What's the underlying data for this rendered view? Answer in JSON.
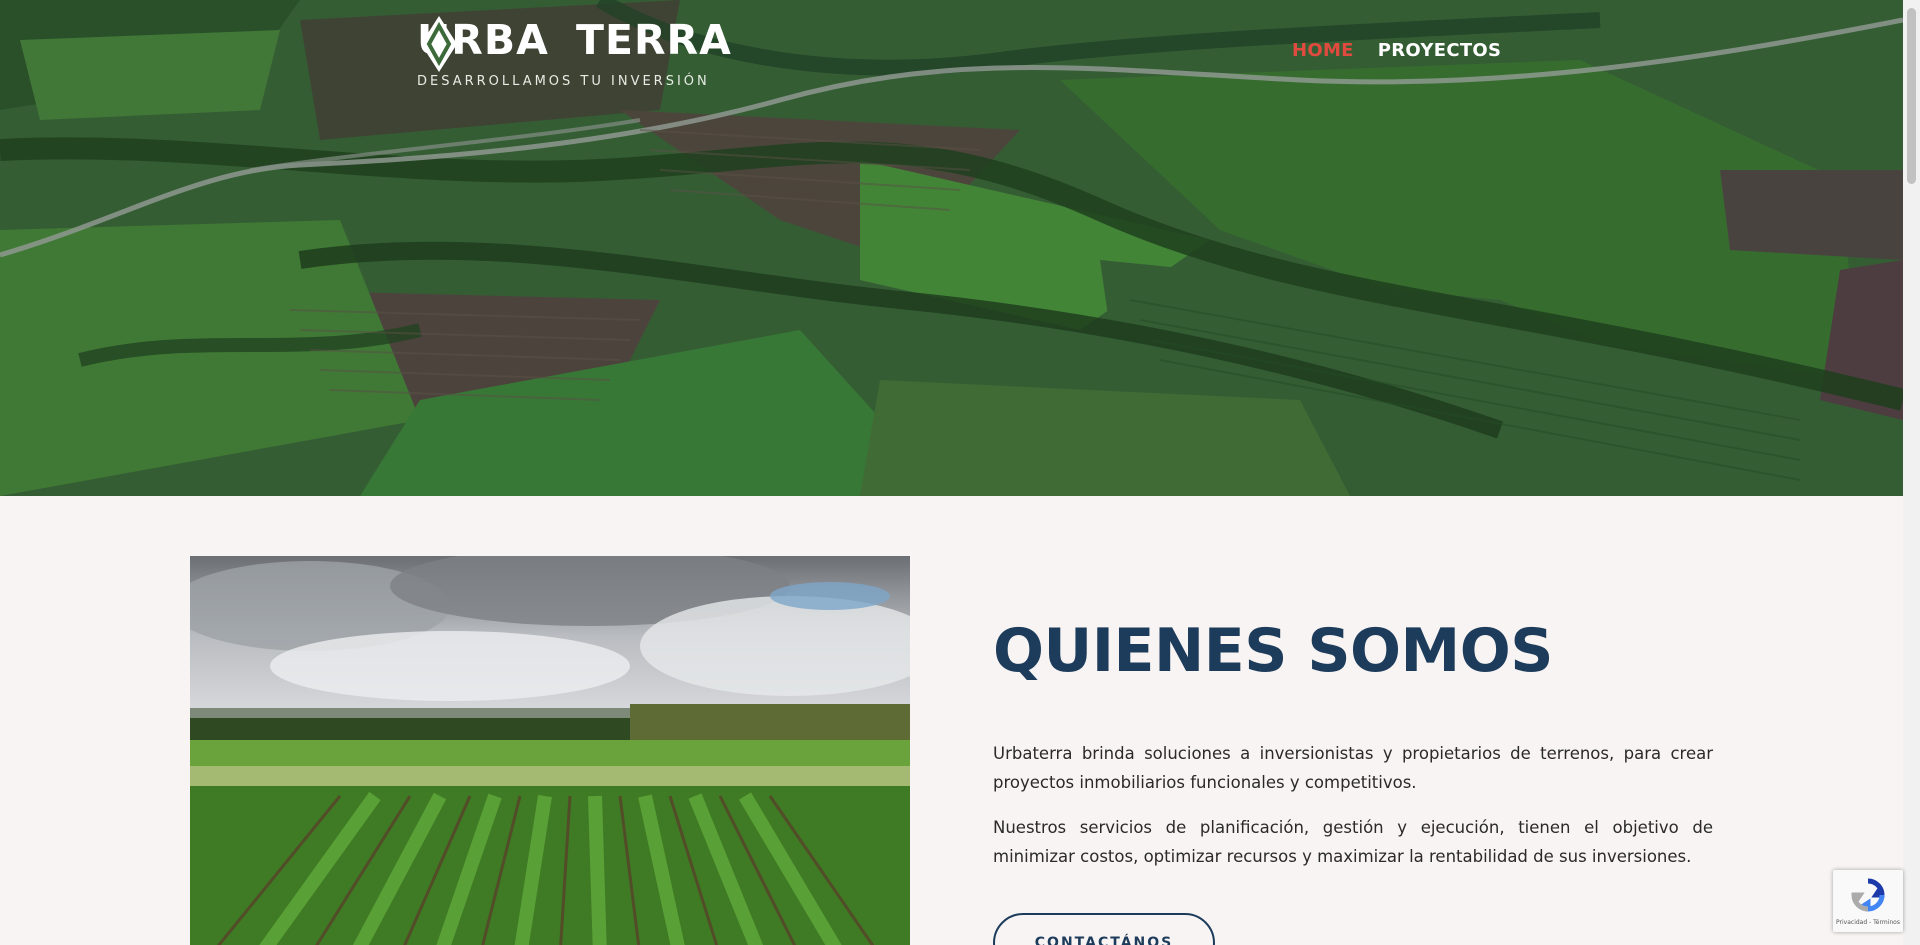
{
  "header": {
    "logo": {
      "word_left": "URBA",
      "word_right": "TERRA",
      "tagline": "DESARROLLAMOS TU INVERSIÓN"
    },
    "nav": [
      {
        "label": "HOME",
        "active": true
      },
      {
        "label": "PROYECTOS",
        "active": false
      }
    ]
  },
  "about": {
    "title": "QUIENES SOMOS",
    "paragraph1": "Urbaterra brinda soluciones a inversionistas y propietarios de terrenos, para crear proyectos inmobiliarios funcionales y competitivos.",
    "paragraph2": "Nuestros servicios de planificación, gestión y ejecución, tienen el objetivo de minimizar costos, optimizar recursos y maximizar la rentabilidad de sus inversiones.",
    "button_label": "CONTACTÁNOS"
  },
  "recaptcha": {
    "icon": "recaptcha-icon",
    "links": "Privacidad - Términos"
  },
  "colors": {
    "accent_red": "#e04a3f",
    "navy": "#1d3b5a",
    "background": "#f8f4f3"
  }
}
